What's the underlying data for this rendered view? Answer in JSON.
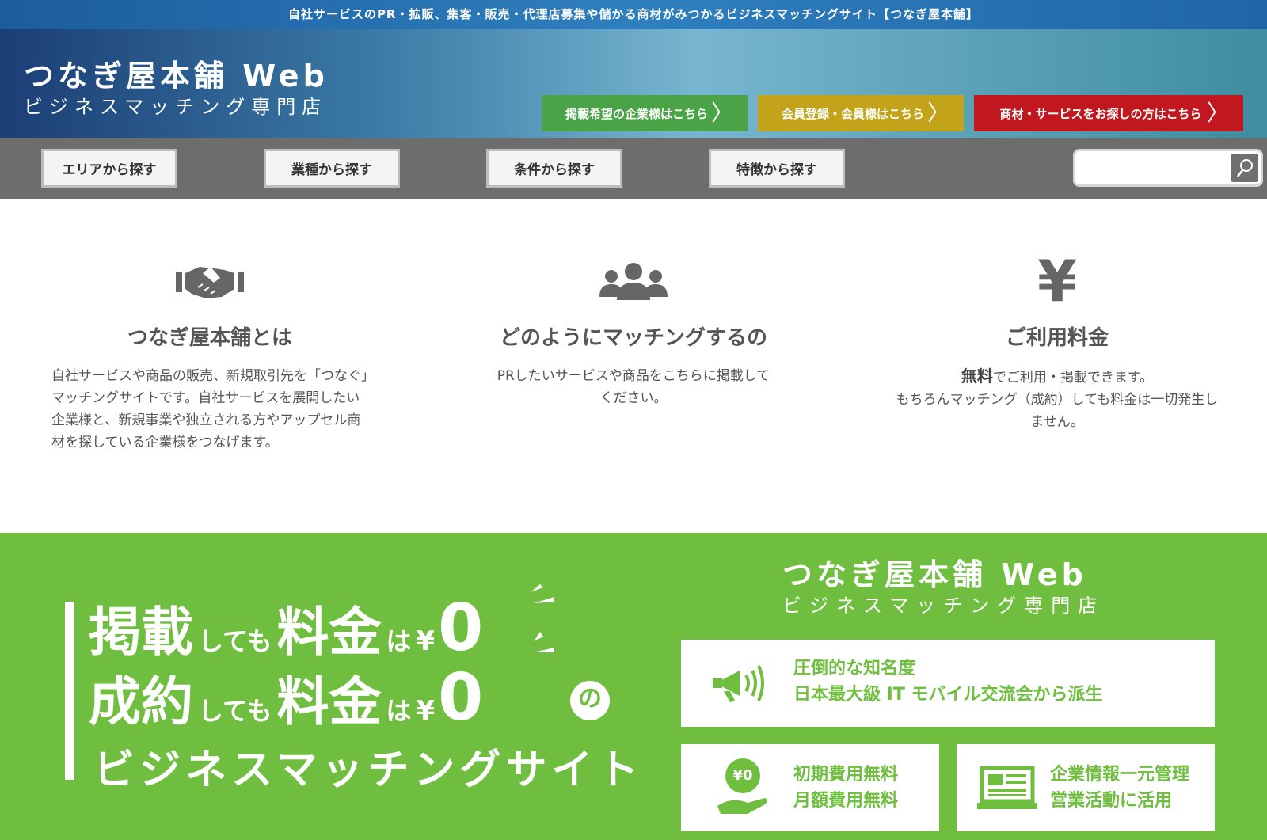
{
  "top_banner": "自社サービスのPR・拡販、集客・販売・代理店募集や儲かる商材がみつかるビジネスマッチングサイト【つなぎ屋本舗】",
  "logo": {
    "main": "つなぎ屋本舗 Web",
    "sub": "ビジネスマッチング専門店"
  },
  "header_buttons": [
    {
      "label": "掲載希望の企業様はこちら",
      "color": "#4aa447"
    },
    {
      "label": "会員登録・会員様はこちら",
      "color": "#c2a31a"
    },
    {
      "label": "商材・サービスをお探しの方はこちら",
      "color": "#c1171f"
    }
  ],
  "nav": [
    "エリアから探す",
    "業種から探す",
    "条件から探す",
    "特徴から探す"
  ],
  "search": {
    "placeholder": ""
  },
  "features": [
    {
      "icon": "handshake-icon",
      "title": "つなぎ屋本舗とは",
      "text": "自社サービスや商品の販売、新規取引先を「つなぐ」マッチングサイトです。自社サービスを展開したい企業様と、新規事業や独立される方やアップセル商材を探している企業様をつなげます。"
    },
    {
      "icon": "group-icon",
      "title": "どのようにマッチングするの",
      "text": "PRしたいサービスや商品をこちらに掲載してください。"
    },
    {
      "icon": "yen-icon",
      "title": "ご利用料金",
      "highlight": "無料",
      "line1_rest": "でご利用・掲載できます。",
      "line2": "もちろんマッチング（成約）しても料金は一切発生しません。"
    }
  ],
  "promo": {
    "line1": {
      "a": "掲載",
      "b": "しても",
      "c": "料金",
      "d": "は",
      "yen": "¥",
      "zero": "0"
    },
    "line2": {
      "a": "成約",
      "b": "しても",
      "c": "料金",
      "d": "は",
      "yen": "¥",
      "zero": "0"
    },
    "no": "の",
    "sub": "ビジネスマッチングサイト",
    "logo_main": "つなぎ屋本舗 Web",
    "logo_sub": "ビジネスマッチング専門店",
    "cards": [
      {
        "icon": "megaphone-icon",
        "line1": "圧倒的な知名度",
        "line2": "日本最大級 IT モバイル交流会から派生"
      },
      {
        "icon": "yen-coin-hand-icon",
        "coin": "¥0",
        "line1": "初期費用無料",
        "line2": "月額費用無料"
      },
      {
        "icon": "laptop-icon",
        "line1": "企業情報一元管理",
        "line2": "営業活動に活用"
      }
    ]
  },
  "colors": {
    "green": "#6fbe3f",
    "nav_gray": "#6d6d6d"
  }
}
